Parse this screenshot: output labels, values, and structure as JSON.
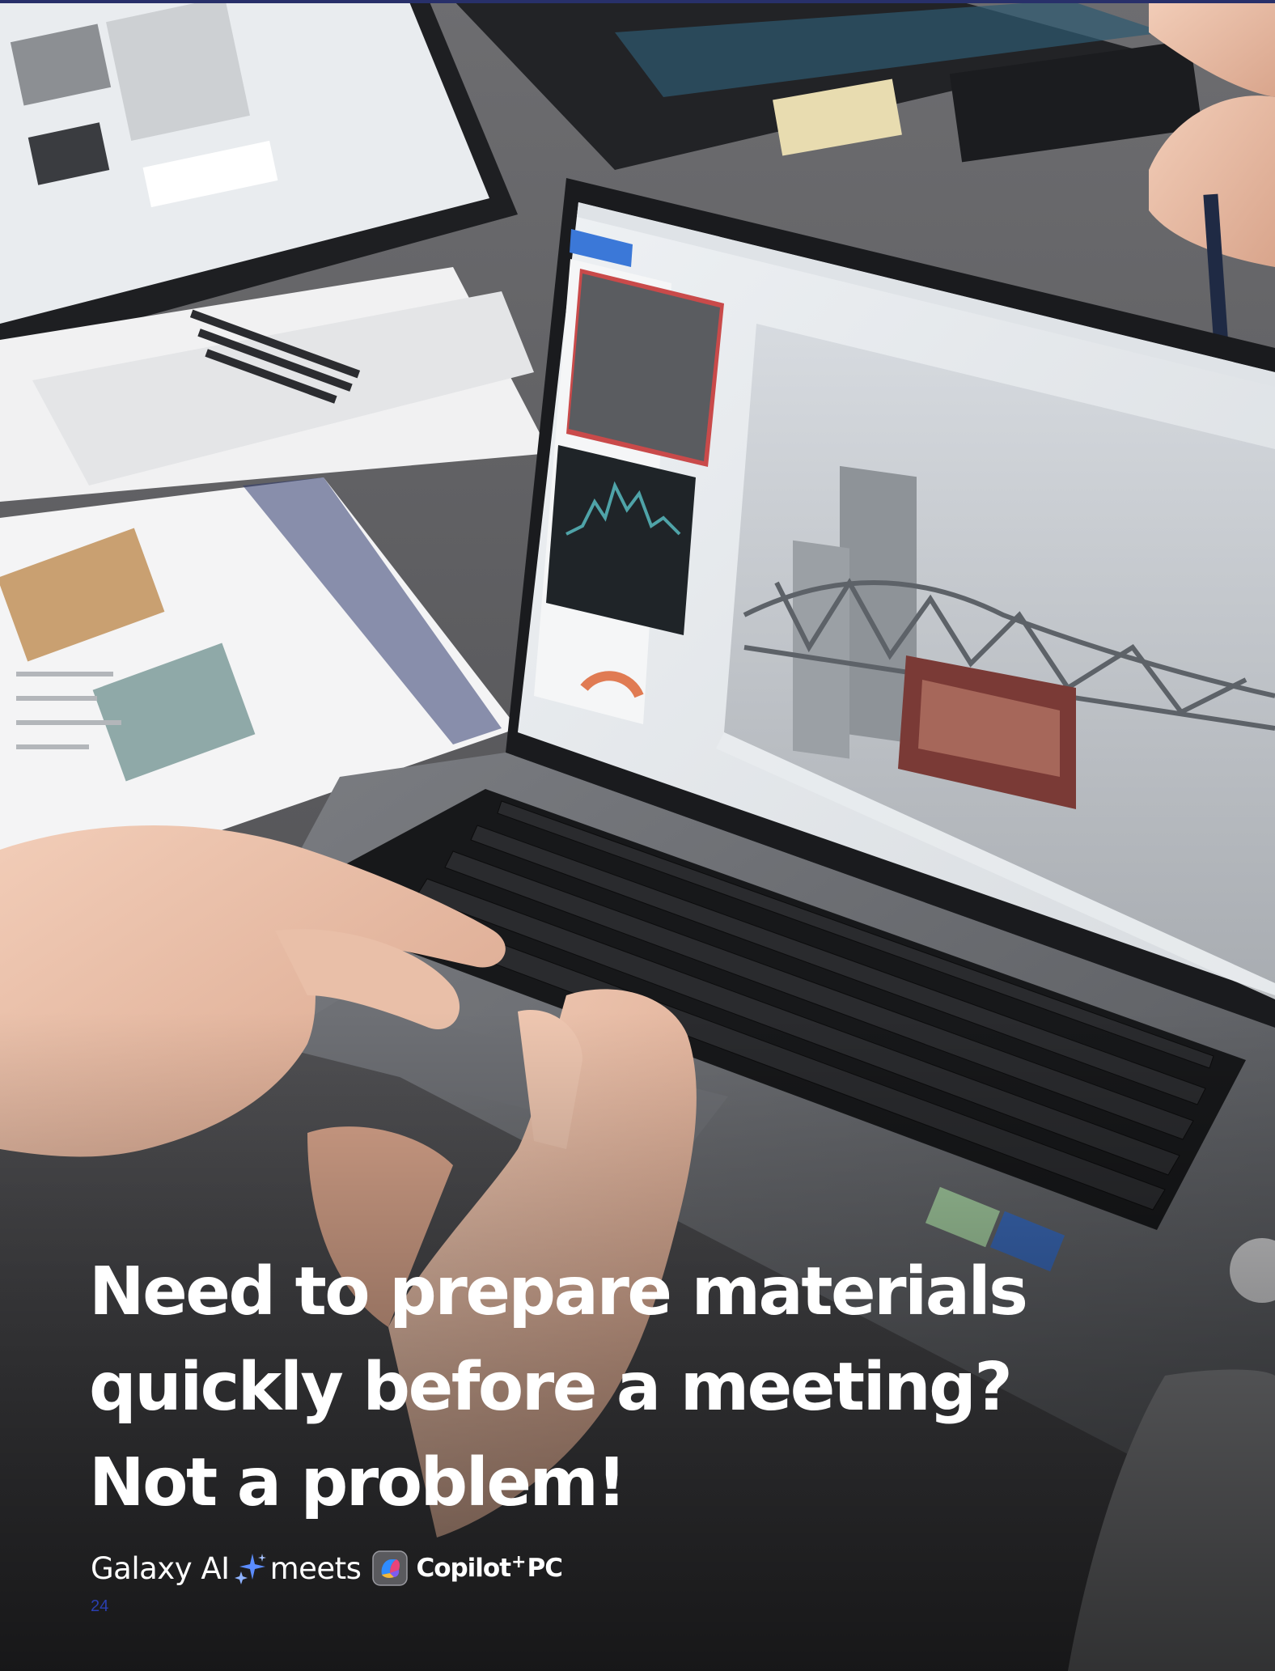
{
  "headline": {
    "line1": "Need to prepare materials",
    "line2": "quickly before a meeting?",
    "line3": "Not a problem!"
  },
  "branding": {
    "galaxy_ai": "Galaxy AI",
    "sparkle_icon": "galaxy-ai-sparkle-icon",
    "meets": "meets",
    "copilot_icon": "copilot-logo-icon",
    "copilot": "Copilot",
    "plus": "+",
    "pc": "PC"
  },
  "page_number": "24",
  "colors": {
    "top_rule": "#28306a",
    "headline_text": "#ffffff",
    "sparkle_blue": "#5b8cff",
    "page_number": "#2a3fb0"
  }
}
